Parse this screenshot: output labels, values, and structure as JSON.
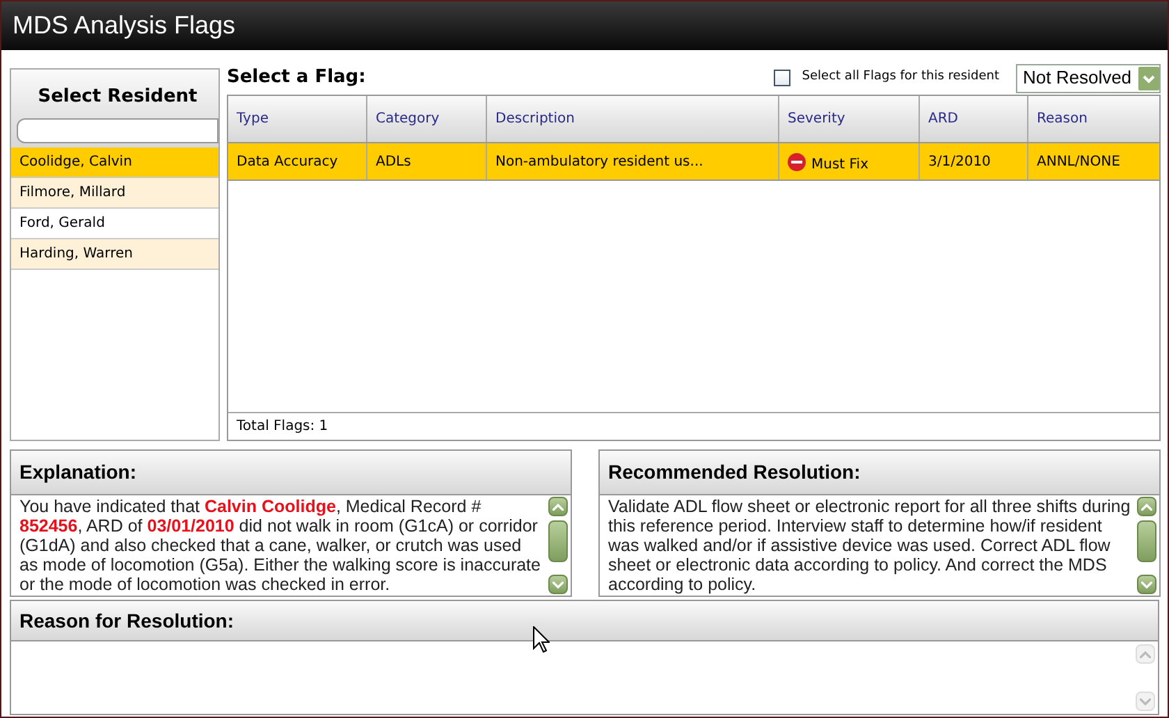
{
  "window": {
    "title": "MDS Analysis Flags"
  },
  "residents": {
    "title": "Select Resident",
    "items": [
      {
        "name": "Coolidge, Calvin",
        "selected": true
      },
      {
        "name": "Filmore, Millard",
        "selected": false
      },
      {
        "name": "Ford, Gerald",
        "selected": false
      },
      {
        "name": "Harding, Warren",
        "selected": false
      }
    ]
  },
  "flags": {
    "title": "Select a Flag:",
    "select_all": {
      "label": "Select all Flags for this resident",
      "checked": false
    },
    "filter": {
      "value": "Not Resolved"
    },
    "table": {
      "columns": [
        "Type",
        "Category",
        "Description",
        "Severity",
        "ARD",
        "Reason"
      ],
      "rows": [
        {
          "type": "Data Accuracy",
          "category": "ADLs",
          "description": "Non-ambulatory resident us...",
          "severity": "Must Fix",
          "ard": "3/1/2010",
          "reason": "ANNL/NONE",
          "selected": true
        }
      ]
    },
    "total": "Total Flags: 1"
  },
  "explanation": {
    "title": "Explanation:",
    "text": "You have indicated that **Calvin Coolidge**, Medical Record # **852456**, ARD of **03/01/2010** did not walk in room (G1cA) or corridor (G1dA) and also checked that a cane, walker, or crutch was used as mode of locomotion (G5a). Either the walking score is inaccurate or the mode of locomotion was checked in error."
  },
  "recommended": {
    "title": "Recommended Resolution:",
    "text": "Validate ADL flow sheet or electronic report for all three shifts during this reference period. Interview staff to determine how/if resident was walked and/or if assistive device was used. Correct ADL flow sheet or electronic data according to policy. And correct the MDS according to policy."
  },
  "reason": {
    "title": "Reason for Resolution:"
  }
}
